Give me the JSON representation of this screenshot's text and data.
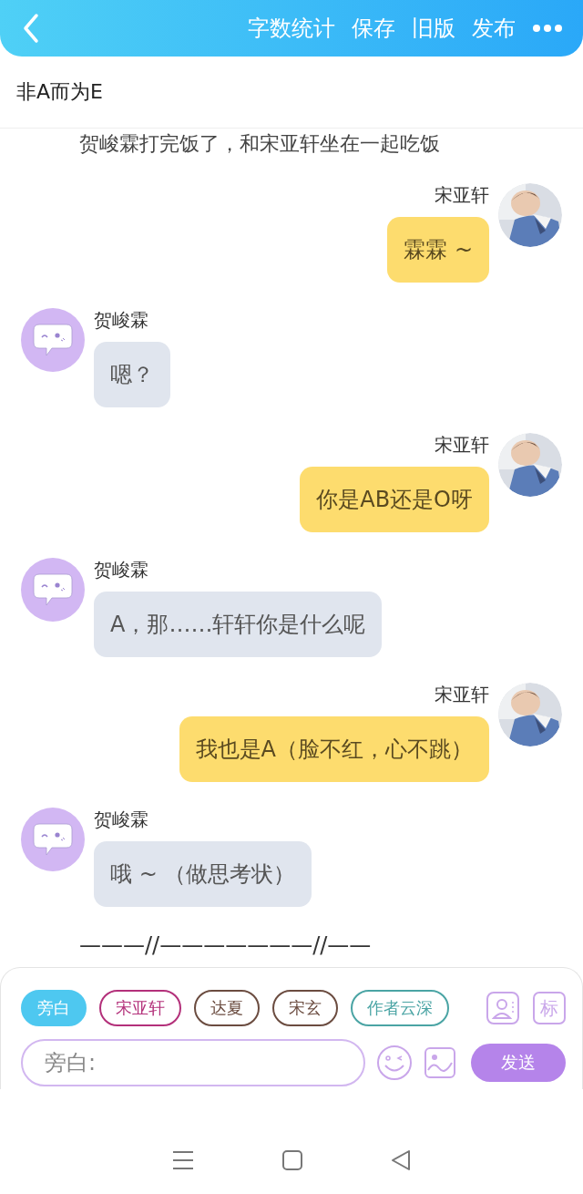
{
  "header": {
    "actions": [
      "字数统计",
      "保存",
      "旧版",
      "发布"
    ]
  },
  "title": "非A而为E",
  "messages": [
    {
      "kind": "narration",
      "text": "贺峻霖打完饭了，和宋亚轩坐在一起吃饭"
    },
    {
      "kind": "outgoing",
      "sender": "宋亚轩",
      "text": "霖霖 ~"
    },
    {
      "kind": "incoming",
      "sender": "贺峻霖",
      "text": "嗯？"
    },
    {
      "kind": "outgoing",
      "sender": "宋亚轩",
      "text": "你是AB还是O呀"
    },
    {
      "kind": "incoming",
      "sender": "贺峻霖",
      "text": "A，那……轩轩你是什么呢"
    },
    {
      "kind": "outgoing",
      "sender": "宋亚轩",
      "text": "我也是A（脸不红，心不跳）"
    },
    {
      "kind": "incoming",
      "sender": "贺峻霖",
      "text": "哦 ~ （做思考状）"
    },
    {
      "kind": "narration",
      "text": "———//———————//——"
    }
  ],
  "roles": [
    {
      "label": "旁白",
      "selected": true,
      "color": "#4ec8f0"
    },
    {
      "label": "宋亚轩",
      "selected": false,
      "color": "#b3307a"
    },
    {
      "label": "达夏",
      "selected": false,
      "color": "#6b4c40"
    },
    {
      "label": "宋玄",
      "selected": false,
      "color": "#6b4c40"
    },
    {
      "label": "作者云深",
      "selected": false,
      "color": "#4aa4a4"
    }
  ],
  "mark_button": "标",
  "input": {
    "placeholder": "旁白:"
  },
  "send_button": "发送"
}
